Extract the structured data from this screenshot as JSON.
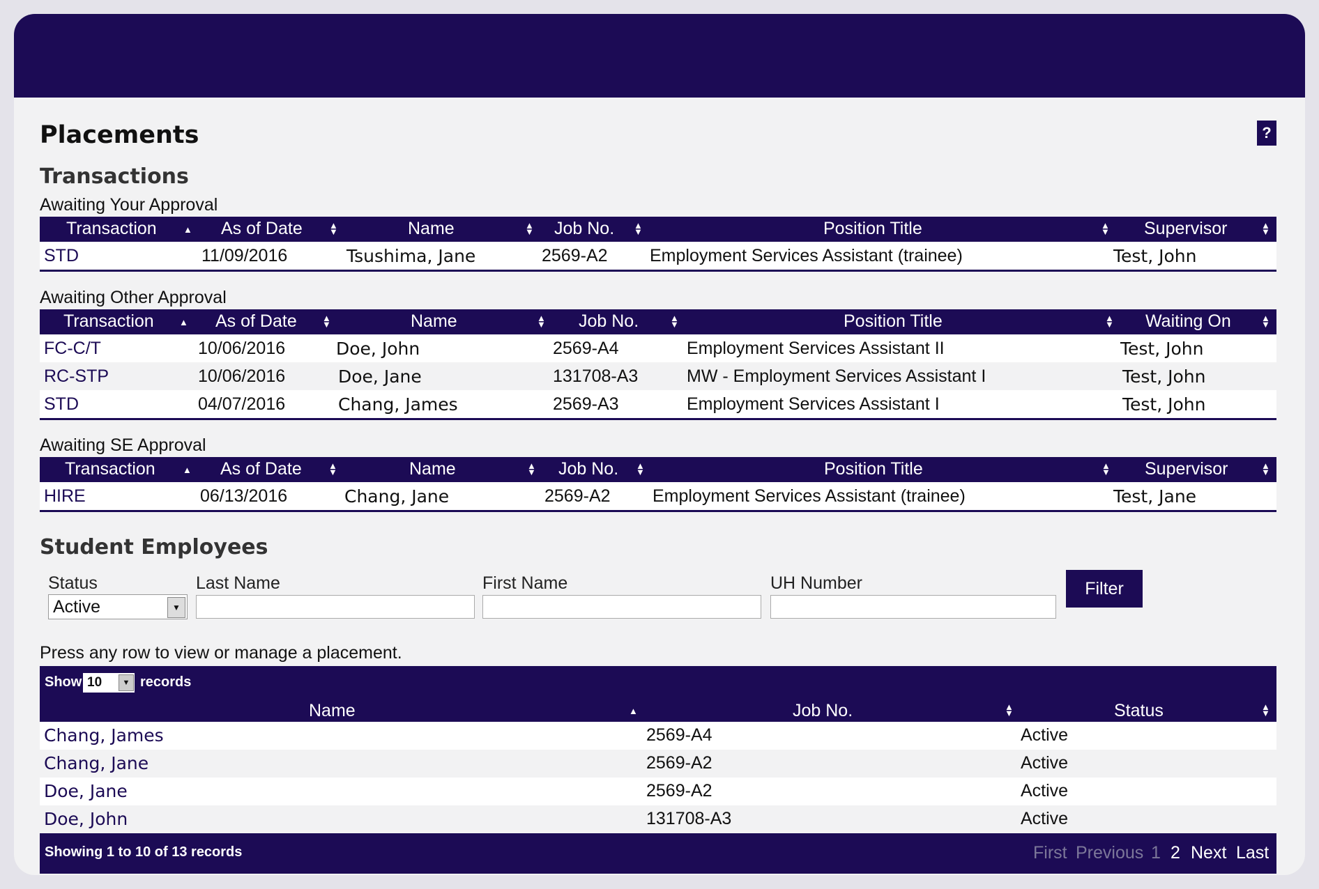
{
  "page": {
    "title": "Placements",
    "help_label": "?"
  },
  "transactions": {
    "heading": "Transactions",
    "your_approval": {
      "label": "Awaiting Your Approval",
      "columns": [
        "Transaction",
        "As of Date",
        "Name",
        "Job No.",
        "Position Title",
        "Supervisor"
      ],
      "rows": [
        {
          "transaction": "STD",
          "date": "11/09/2016",
          "name": "Tsushima, Jane",
          "job": "2569-A2",
          "title": "Employment Services Assistant (trainee)",
          "person": "Test, John"
        }
      ]
    },
    "other_approval": {
      "label": "Awaiting Other Approval",
      "columns": [
        "Transaction",
        "As of Date",
        "Name",
        "Job No.",
        "Position Title",
        "Waiting On"
      ],
      "rows": [
        {
          "transaction": "FC-C/T",
          "date": "10/06/2016",
          "name": "Doe, John",
          "job": "2569-A4",
          "title": "Employment Services Assistant II",
          "person": "Test, John"
        },
        {
          "transaction": "RC-STP",
          "date": "10/06/2016",
          "name": "Doe, Jane",
          "job": "131708-A3",
          "title": "MW - Employment Services Assistant I",
          "person": "Test, John"
        },
        {
          "transaction": "STD",
          "date": "04/07/2016",
          "name": "Chang, James",
          "job": "2569-A3",
          "title": "Employment Services Assistant I",
          "person": "Test, John"
        }
      ]
    },
    "se_approval": {
      "label": "Awaiting SE Approval",
      "columns": [
        "Transaction",
        "As of Date",
        "Name",
        "Job No.",
        "Position Title",
        "Supervisor"
      ],
      "rows": [
        {
          "transaction": "HIRE",
          "date": "06/13/2016",
          "name": "Chang, Jane",
          "job": "2569-A2",
          "title": "Employment Services Assistant (trainee)",
          "person": "Test, Jane"
        }
      ]
    }
  },
  "students": {
    "heading": "Student Employees",
    "filter": {
      "status_label": "Status",
      "status_value": "Active",
      "last_name_label": "Last Name",
      "last_name_value": "",
      "first_name_label": "First Name",
      "first_name_value": "",
      "uh_label": "UH Number",
      "uh_value": "",
      "button": "Filter"
    },
    "hint": "Press any row to view or manage a placement.",
    "show_label": "Show",
    "show_value": "10",
    "records_label": "records",
    "columns": [
      "Name",
      "Job No.",
      "Status"
    ],
    "rows": [
      {
        "name": "Chang, James",
        "job": "2569-A4",
        "status": "Active"
      },
      {
        "name": "Chang, Jane",
        "job": "2569-A2",
        "status": "Active"
      },
      {
        "name": "Doe, Jane",
        "job": "2569-A2",
        "status": "Active"
      },
      {
        "name": "Doe, John",
        "job": "131708-A3",
        "status": "Active"
      }
    ],
    "info": "Showing 1 to 10 of 13 records",
    "pagination": {
      "first": "First",
      "previous": "Previous",
      "page1": "1",
      "page2": "2",
      "next": "Next",
      "last": "Last"
    }
  },
  "colors": {
    "brand": "#1c0b55",
    "background": "#f2f2f3"
  }
}
